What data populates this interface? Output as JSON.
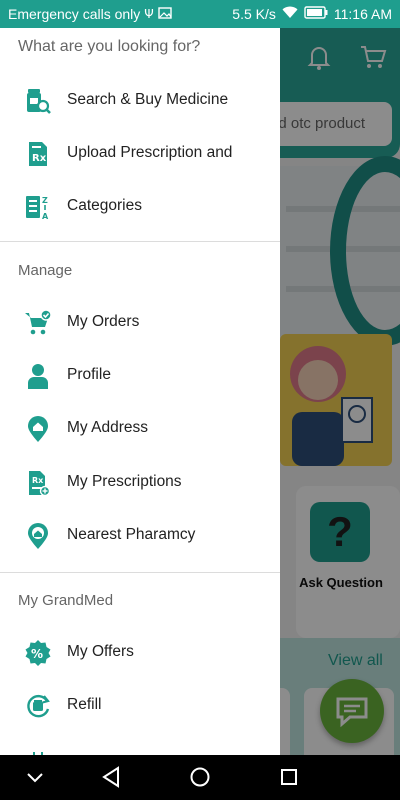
{
  "colors": {
    "accent": "#1f9e8e",
    "accent_dark": "#197f72",
    "status_bar": "#1f9e8e",
    "promo_yellow": "#f3cf52",
    "fab_green": "#6ab53d"
  },
  "status_bar": {
    "carrier_text": "Emergency calls only",
    "network_speed": "5.5 K/s",
    "time": "11:16 AM",
    "icons": [
      "usb-icon",
      "image-icon",
      "wifi-icon",
      "battery-icon"
    ]
  },
  "background_app": {
    "search_placeholder": "nd otc product",
    "tile_label": "Ask Question",
    "view_all": "View all",
    "icons": [
      "bell-icon",
      "cart-icon",
      "question-icon",
      "chat-icon"
    ]
  },
  "drawer": {
    "header": "What are you looking for?",
    "sections": [
      {
        "label": "",
        "items": [
          {
            "label": "Search & Buy Medicine",
            "icon": "medicine-search-icon"
          },
          {
            "label": "Upload Prescription and",
            "icon": "prescription-upload-icon"
          },
          {
            "label": "Categories",
            "icon": "categories-sort-icon"
          }
        ]
      },
      {
        "label": "Manage",
        "items": [
          {
            "label": "My Orders",
            "icon": "cart-check-icon"
          },
          {
            "label": "Profile",
            "icon": "person-icon"
          },
          {
            "label": "My Address",
            "icon": "home-pin-icon"
          },
          {
            "label": "My Prescriptions",
            "icon": "prescription-doc-icon"
          },
          {
            "label": "Nearest Pharamcy",
            "icon": "pharmacy-pin-icon"
          }
        ]
      },
      {
        "label": "My GrandMed",
        "items": [
          {
            "label": "My Offers",
            "icon": "offer-percent-icon"
          },
          {
            "label": "Refill",
            "icon": "refill-icon"
          }
        ]
      }
    ]
  },
  "nav_bar": {
    "icons": [
      "hide-keyboard-icon",
      "back-icon",
      "home-icon",
      "recents-icon"
    ]
  }
}
